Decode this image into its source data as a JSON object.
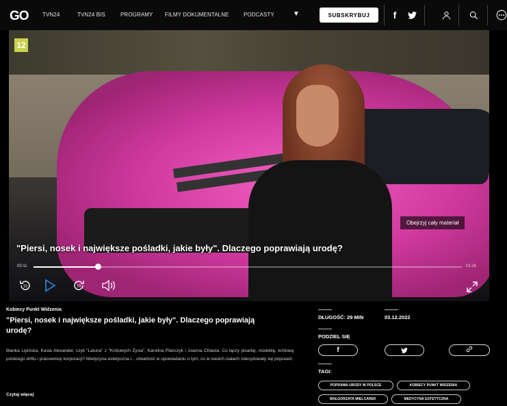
{
  "nav": {
    "logo": "GO",
    "items": [
      "TVN24",
      "TVN24 BIS",
      "PROGRAMY",
      "FILMY DOKUMENTALNE",
      "PODCASTY"
    ],
    "subscribe_label": "SUBSKRYBUJ",
    "social": {
      "facebook": "f",
      "twitter": "twitter-icon"
    }
  },
  "video": {
    "age_rating": "12",
    "watch_full_label": "Obejrzyj cały materiał",
    "overlay_title": "\"Piersi, nosek i największe pośladki, jakie były\". Dlaczego poprawiają urodę?",
    "time_current": "00:11",
    "time_total": "01:16",
    "progress": 0.15,
    "colors": {
      "car": "#d13a9f"
    }
  },
  "article": {
    "show_name": "Kobiecy Punkt Widzenia",
    "title": "\"Piersi, nosek i największe pośladki, jakie były\". Dlaczego poprawiają urodę?",
    "description": "Blanka Lipińska, Kasia Alexander, czyli \"Laluna\" z \"Królowych Życia\", Karolina Pilarczyk i Joanna Chlasta. Co łączy pisarkę, modelkę, królową polskiego driftu i pracownicę korporacji? Medycyna estetyczna i... otwartość w opowiadaniu o tym, co w swoich ciałach zdecydowały się poprawić.",
    "read_more": "Czytaj więcej"
  },
  "meta": {
    "duration": "DŁUGOŚĆ: 29 MIN",
    "date": "03.12.2022",
    "share_label": "PODZIEL SIĘ",
    "share_buttons": [
      {
        "name": "share-facebook-button",
        "icon": "facebook-icon",
        "glyph": "f"
      },
      {
        "name": "share-twitter-button",
        "icon": "twitter-icon",
        "glyph": ""
      },
      {
        "name": "share-link-button",
        "icon": "link-icon",
        "glyph": ""
      }
    ],
    "tags_label": "TAGI:",
    "tags": [
      "POPRAWA URODY W POLSCE",
      "KOBIECY PUNKT WIDZENIA",
      "MAŁGORZATA MIELCAREK",
      "MEDYCYNA ESTETYCZNA"
    ]
  }
}
